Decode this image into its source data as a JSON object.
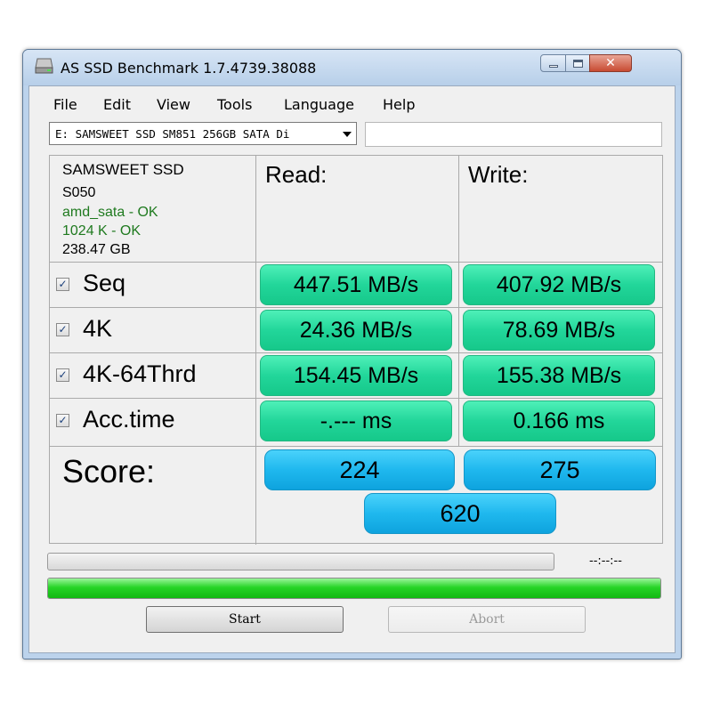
{
  "window": {
    "title": "AS SSD Benchmark 1.7.4739.38088",
    "close_glyph": "✕"
  },
  "menu": [
    "File",
    "Edit",
    "View",
    "Tools",
    "Language",
    "Help"
  ],
  "drive_select": {
    "value": "E: SAMSWEET  SSD SM851 256GB SATA Di"
  },
  "drive_info": {
    "name": "SAMSWEET SSD",
    "firmware": "S050",
    "driver_status": "amd_sata - OK",
    "alignment_status": "1024 K - OK",
    "capacity": "238.47 GB",
    "ok_color": "#1f7a1f"
  },
  "columns": {
    "read": "Read:",
    "write": "Write:"
  },
  "tests": [
    {
      "label": "Seq",
      "checked": true,
      "read": "447.51 MB/s",
      "write": "407.92 MB/s"
    },
    {
      "label": "4K",
      "checked": true,
      "read": "24.36 MB/s",
      "write": "78.69 MB/s"
    },
    {
      "label": "4K-64Thrd",
      "checked": true,
      "read": "154.45 MB/s",
      "write": "155.38 MB/s"
    },
    {
      "label": "Acc.time",
      "checked": true,
      "read": "-.--- ms",
      "write": "0.166 ms"
    }
  ],
  "checkmark": "✓",
  "score": {
    "label": "Score:",
    "read": "224",
    "write": "275",
    "total": "620"
  },
  "elapsed_time": "--:--:--",
  "progress": {
    "value": 1.0,
    "color": "#1fcc1f"
  },
  "buttons": {
    "start": "Start",
    "abort": "Abort"
  },
  "colors": {
    "result_green": "#22d69a",
    "score_blue": "#1fb8ee"
  }
}
